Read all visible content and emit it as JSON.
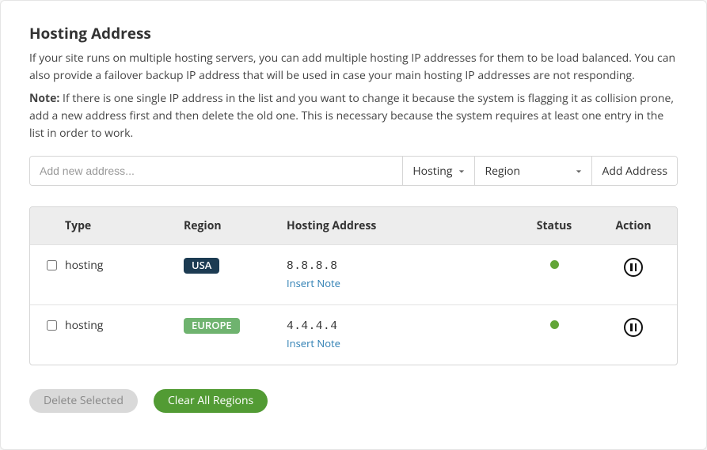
{
  "title": "Hosting Address",
  "lead": "If your site runs on multiple hosting servers, you can add multiple hosting IP addresses for them to be load balanced. You can also provide a failover backup IP address that will be used in case your main hosting IP addresses are not responding.",
  "note_label": "Note:",
  "note_text": " If there is one single IP address in the list and you want to change it because the system is flagging it as collision prone, add a new address first and then delete the old one. This is necessary because the system requires at least one entry in the list in order to work.",
  "addbar": {
    "placeholder": "Add new address...",
    "type_label": "Hosting",
    "region_label": "Region",
    "add_label": "Add Address"
  },
  "columns": {
    "type": "Type",
    "region": "Region",
    "address": "Hosting Address",
    "status": "Status",
    "action": "Action"
  },
  "rows": [
    {
      "type": "hosting",
      "region": "USA",
      "region_style": "dark",
      "address": "8.8.8.8",
      "note": "Insert Note",
      "status": "up"
    },
    {
      "type": "hosting",
      "region": "EUROPE",
      "region_style": "green",
      "address": "4.4.4.4",
      "note": "Insert Note",
      "status": "up"
    }
  ],
  "buttons": {
    "delete": "Delete Selected",
    "clear": "Clear All Regions"
  }
}
